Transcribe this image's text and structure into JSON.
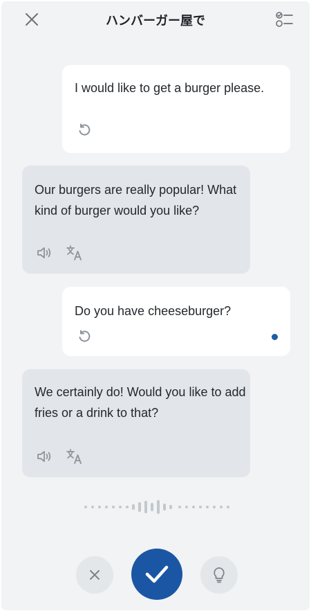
{
  "header": {
    "title": "ハンバーガー屋で",
    "close_icon": "close-icon",
    "checklist_icon": "checklist-icon"
  },
  "messages": [
    {
      "role": "user",
      "text": "I would like to get a burger please.",
      "icons": [
        "replay-icon"
      ]
    },
    {
      "role": "assistant",
      "text": "Our burgers are really popular! What kind of burger would you like?",
      "icons": [
        "speaker-icon",
        "translate-icon"
      ]
    },
    {
      "role": "user",
      "text": "Do you have cheeseburger?",
      "icons": [
        "replay-icon",
        "status-dot"
      ]
    },
    {
      "role": "assistant",
      "text": "We certainly do! Would you like to add fries or a drink to that?",
      "icons": [
        "speaker-icon",
        "translate-icon"
      ]
    }
  ],
  "controls": {
    "cancel_icon": "close-icon",
    "confirm_icon": "check-icon",
    "hint_icon": "lightbulb-icon"
  },
  "colors": {
    "background": "#f1f3f4",
    "user_bubble": "#ffffff",
    "assistant_bubble": "#e2e6ea",
    "accent": "#1b56a4",
    "status_dot": "#1d5ca8",
    "icon_gray": "#8d949b"
  }
}
